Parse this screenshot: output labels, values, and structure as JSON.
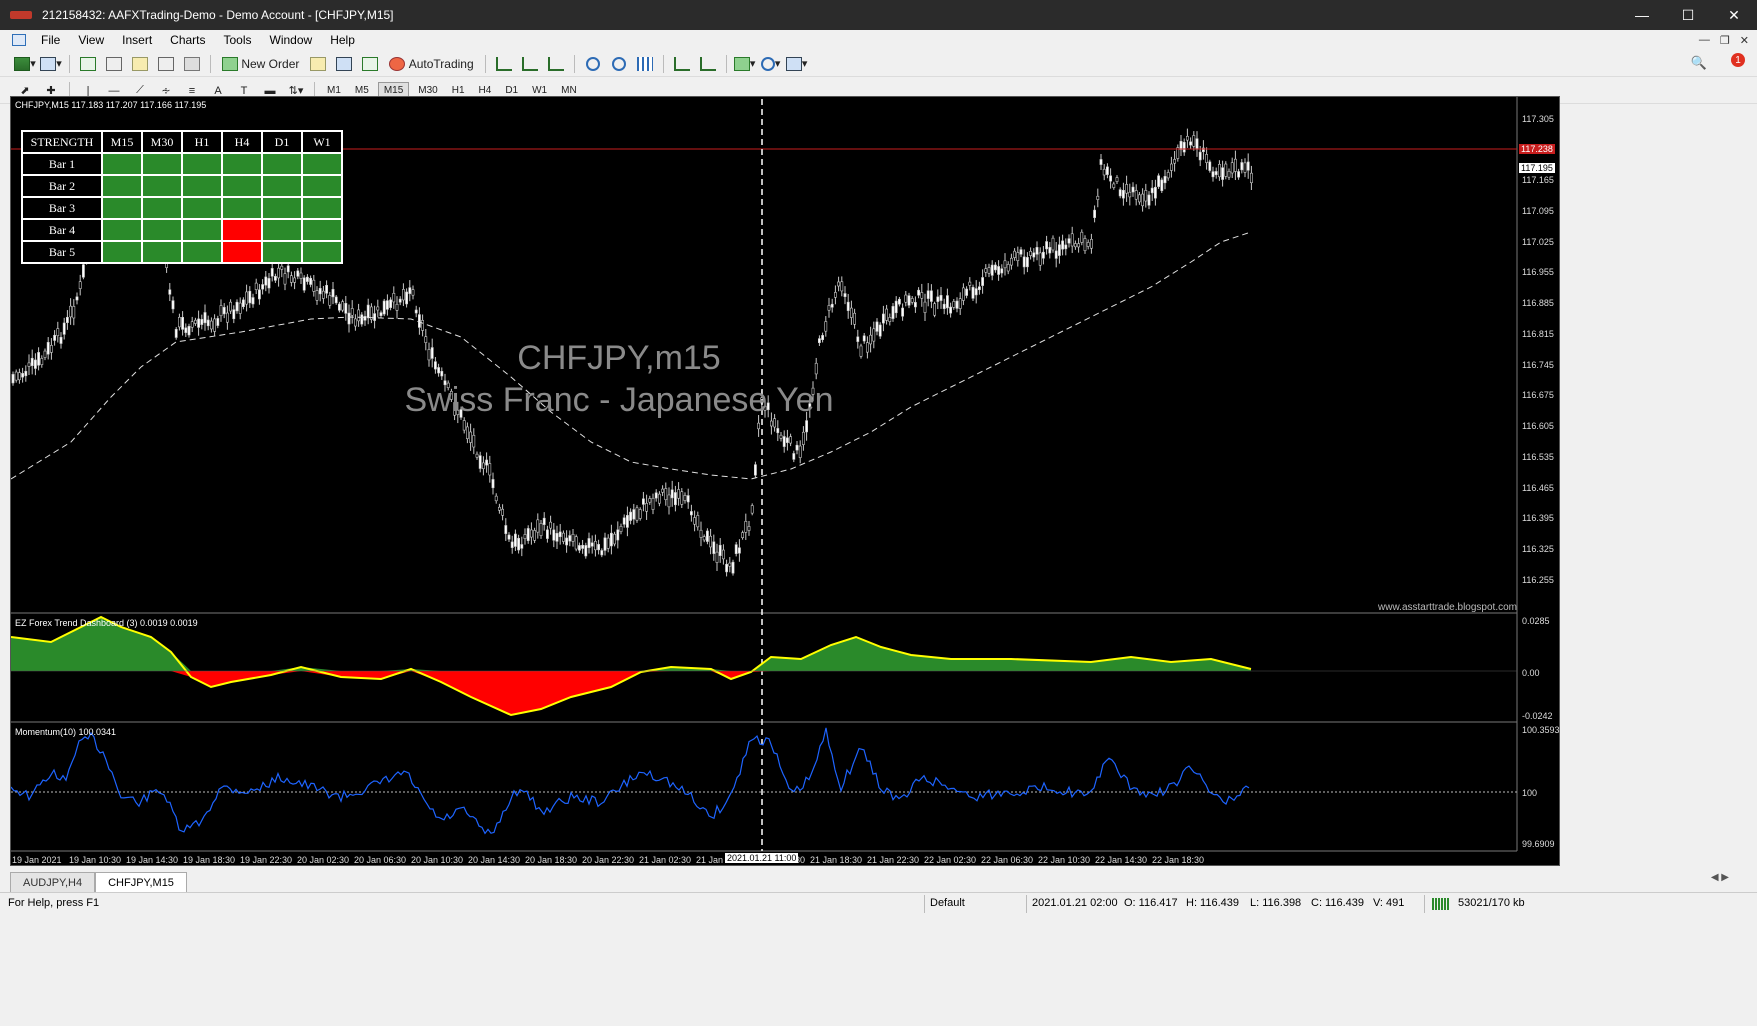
{
  "window": {
    "title": "212158432: AAFXTrading-Demo - Demo Account - [CHFJPY,M15]"
  },
  "menu": [
    "File",
    "View",
    "Insert",
    "Charts",
    "Tools",
    "Window",
    "Help"
  ],
  "toolbar": {
    "new_order_label": "New Order",
    "autotrading_label": "AutoTrading",
    "notification_count": "1",
    "timeframes": [
      "M1",
      "M5",
      "M15",
      "M30",
      "H1",
      "H4",
      "D1",
      "W1",
      "MN"
    ],
    "active_timeframe": "M15"
  },
  "chart": {
    "header": "CHFJPY,M15  117.183 117.207 117.166 117.195",
    "symbol_watermark": "CHFJPY,m15",
    "description_watermark": "Swiss Franc - Japanese Yen",
    "website": "www.asstarttrade.blogspot.com",
    "current_bid": "117.195",
    "red_line_price": "117.238",
    "price_scale": [
      "117.305",
      "117.165",
      "117.095",
      "117.025",
      "116.955",
      "116.885",
      "116.815",
      "116.745",
      "116.675",
      "116.605",
      "116.535",
      "116.465",
      "116.395",
      "116.325",
      "116.255"
    ],
    "indicator1_header": "EZ Forex Trend Dashboard (3) 0.0019 0.0019",
    "indicator1_scale": [
      "0.0285",
      "0.00",
      "-0.0242"
    ],
    "indicator2_header": "Momentum(10) 100.0341",
    "indicator2_scale": [
      "100.3593",
      "100",
      "99.6909"
    ],
    "time_labels": [
      "19 Jan 2021",
      "19 Jan 10:30",
      "19 Jan 14:30",
      "19 Jan 18:30",
      "19 Jan 22:30",
      "20 Jan 02:30",
      "20 Jan 06:30",
      "20 Jan 10:30",
      "20 Jan 14:30",
      "20 Jan 18:30",
      "20 Jan 22:30",
      "21 Jan 02:30",
      "21 Jan",
      "21 Jan 14:30",
      "21 Jan 18:30",
      "21 Jan 22:30",
      "22 Jan 02:30",
      "22 Jan 06:30",
      "22 Jan 10:30",
      "22 Jan 14:30",
      "22 Jan 18:30"
    ],
    "cursor_time": "2021.01.21 11:00"
  },
  "dashboard": {
    "headers": [
      "STRENGTH",
      "M15",
      "M30",
      "H1",
      "H4",
      "D1",
      "W1"
    ],
    "rows": [
      {
        "label": "Bar 1",
        "cells": [
          "green",
          "green",
          "green",
          "green",
          "green",
          "green"
        ]
      },
      {
        "label": "Bar 2",
        "cells": [
          "green",
          "green",
          "green",
          "green",
          "green",
          "green"
        ]
      },
      {
        "label": "Bar 3",
        "cells": [
          "green",
          "green",
          "green",
          "green",
          "green",
          "green"
        ]
      },
      {
        "label": "Bar 4",
        "cells": [
          "green",
          "green",
          "green",
          "red",
          "green",
          "green"
        ]
      },
      {
        "label": "Bar 5",
        "cells": [
          "green",
          "green",
          "green",
          "red",
          "green",
          "green"
        ]
      }
    ]
  },
  "tabs": [
    "AUDJPY,H4",
    "CHFJPY,M15"
  ],
  "active_tab": "CHFJPY,M15",
  "status": {
    "help": "For Help, press F1",
    "profile": "Default",
    "datetime": "2021.01.21 02:00",
    "open": "O: 116.417",
    "high": "H: 116.439",
    "low": "L: 116.398",
    "close": "C: 116.439",
    "volume": "V: 491",
    "traffic": "53021/170 kb"
  },
  "colors": {
    "bull_fill": "#2a8a2a",
    "bear_fill": "#ff0000",
    "curve": "#ffff00",
    "momentum": "#1e64ff",
    "price_line": "#c81e1e"
  }
}
